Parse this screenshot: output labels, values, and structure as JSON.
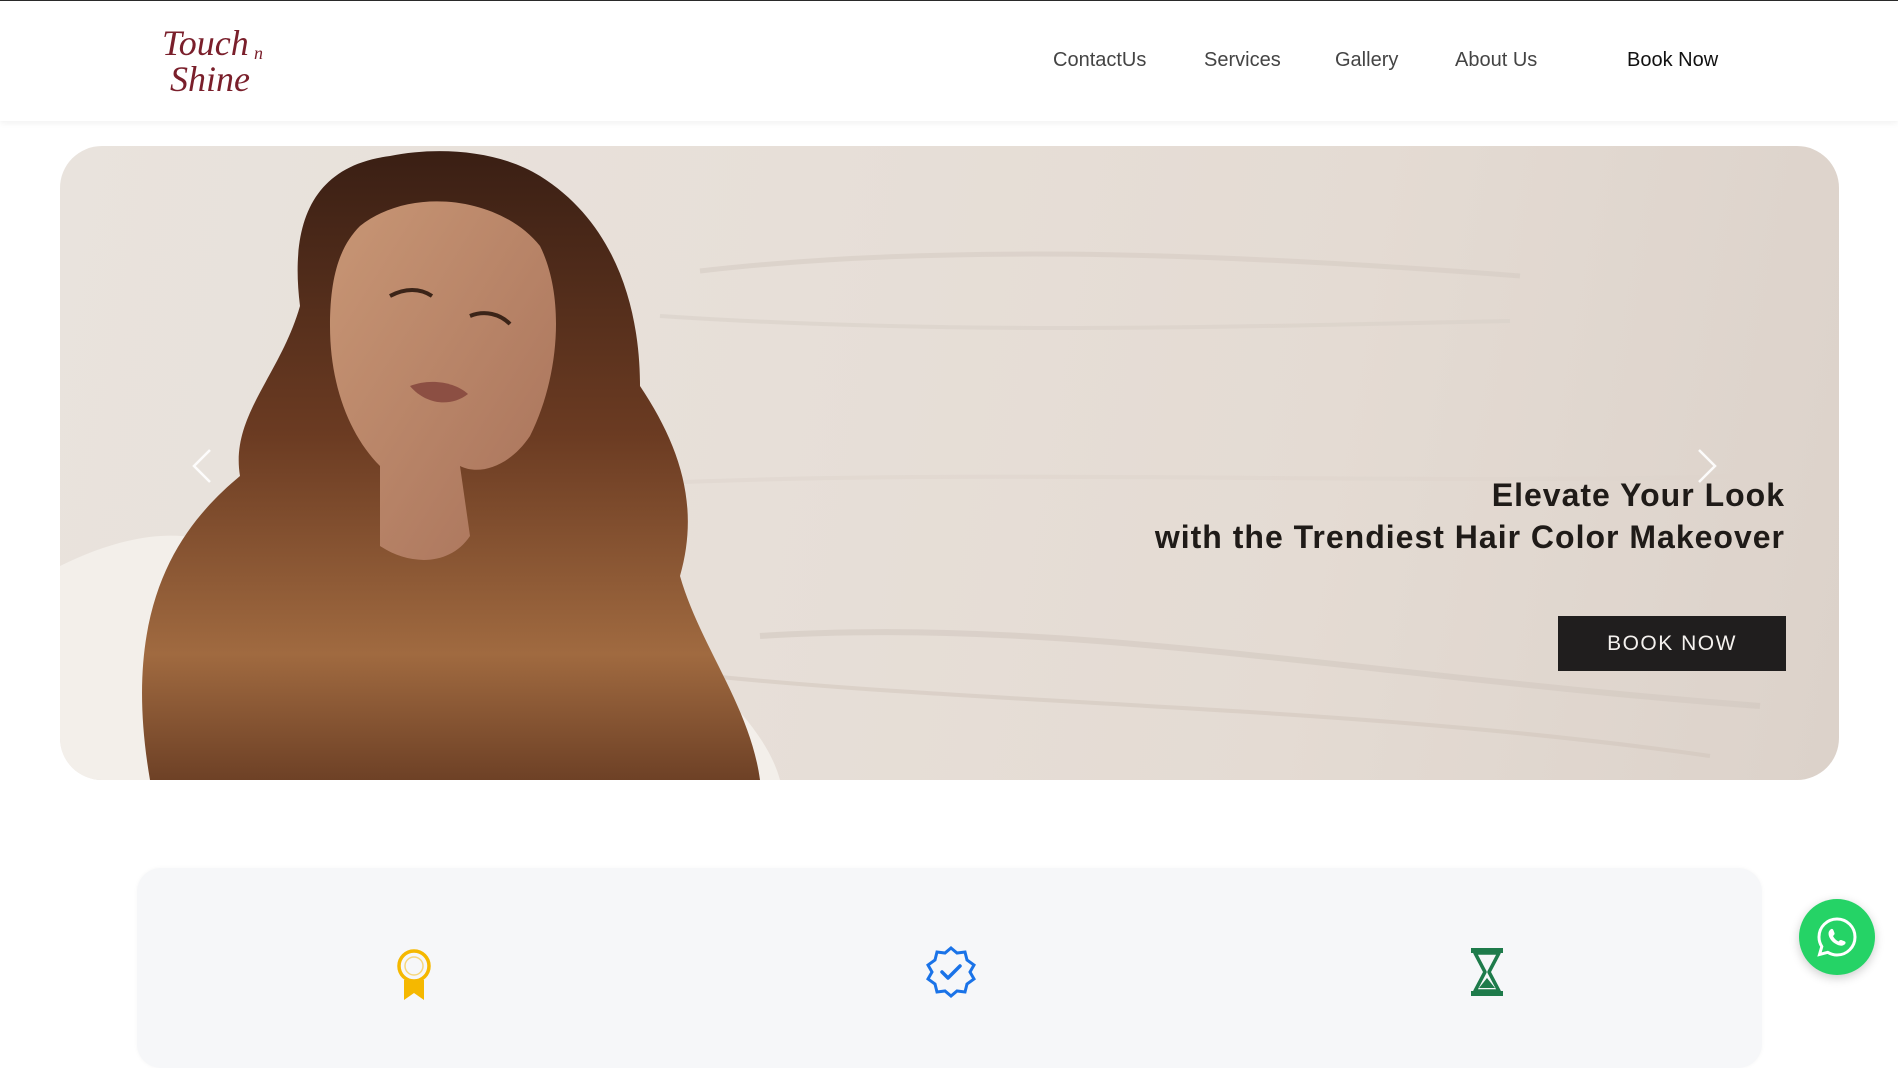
{
  "brand": {
    "logo_top": "Touch",
    "logo_n": "n",
    "logo_bottom": "Shine",
    "color": "#7a1f2b"
  },
  "nav": {
    "items": [
      {
        "label": "ContactUs"
      },
      {
        "label": "Services"
      },
      {
        "label": "Gallery"
      },
      {
        "label": "About Us"
      }
    ],
    "book_label": "Book Now"
  },
  "hero": {
    "line1": "Elevate Your Look",
    "line2": "with the Trendiest Hair Color Makeover",
    "cta_label": "BOOK  NOW",
    "prev_icon": "chevron-left-icon",
    "next_icon": "chevron-right-icon"
  },
  "features": {
    "icons": [
      "award-icon",
      "verified-badge-icon",
      "hourglass-icon"
    ],
    "colors": {
      "award": "#f5b800",
      "verified": "#1a73e8",
      "hourglass": "#1e7b4b"
    }
  },
  "whatsapp": {
    "icon": "whatsapp-icon",
    "color": "#25d366"
  }
}
